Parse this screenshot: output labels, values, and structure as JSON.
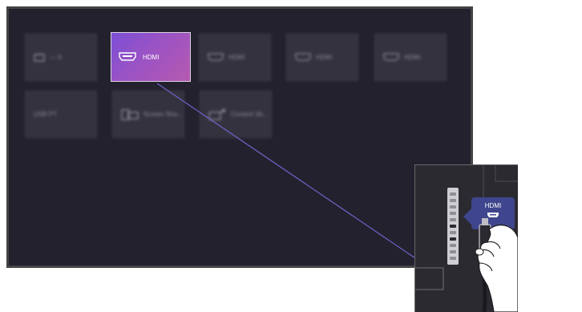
{
  "screen": {
    "tiles_row1": [
      {
        "label": "— II",
        "icon": "tv-icon",
        "active": false
      },
      {
        "label": "HDMI",
        "icon": "hdmi-icon",
        "active": true
      },
      {
        "label": "HDMI",
        "icon": "hdmi-icon",
        "active": false
      },
      {
        "label": "HDMI",
        "icon": "hdmi-icon",
        "active": false
      },
      {
        "label": "HDMI",
        "icon": "hdmi-icon",
        "active": false
      }
    ],
    "tiles_row2": [
      {
        "label": "USB PT",
        "icon": "",
        "active": false
      },
      {
        "label": "Screen Sha...",
        "icon": "screen-share-icon",
        "active": false
      },
      {
        "label": "Content Sh...",
        "icon": "content-share-icon",
        "active": false
      }
    ]
  },
  "inset": {
    "port_label": "HDMI"
  },
  "colors": {
    "screen_bg": "#24212f",
    "tile_bg": "#35323f",
    "active_gradient_start": "#7b4fd6",
    "active_gradient_end": "#b65ab0",
    "connector_line": "#6a66c8",
    "popup_bg": "#3f468d"
  }
}
